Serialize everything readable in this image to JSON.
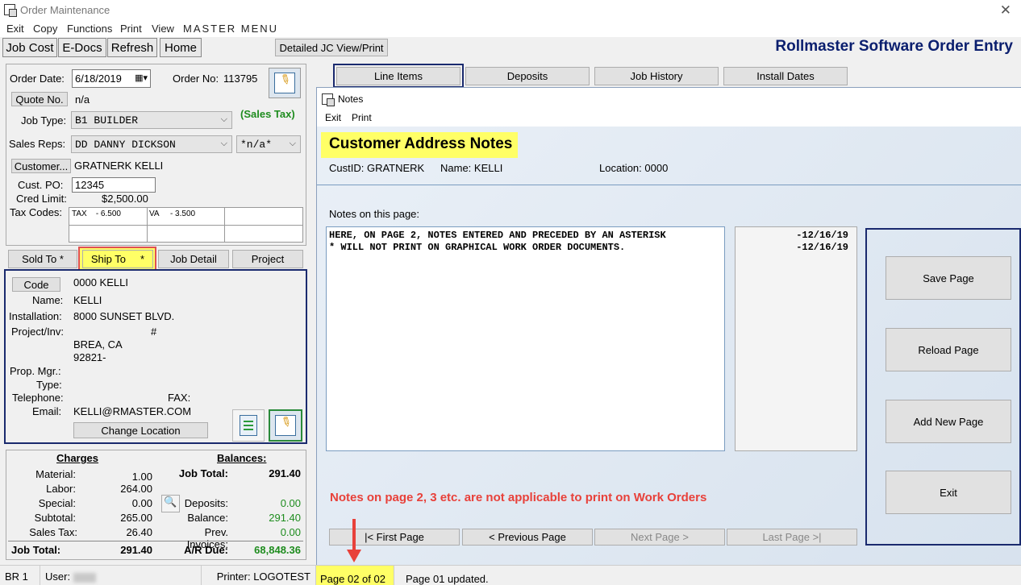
{
  "window": {
    "title": "Order Maintenance",
    "brand": "Rollmaster Software Order Entry",
    "menu": [
      "Exit",
      "Copy",
      "Functions",
      "Print",
      "View",
      "MASTER MENU"
    ]
  },
  "toolbar": {
    "job_cost": "Job Cost",
    "edocs": "E-Docs",
    "refresh": "Refresh",
    "home": "Home",
    "detailed_jc": "Detailed JC View/Print"
  },
  "tabs": [
    "Line Items",
    "Deposits",
    "Job History",
    "Install Dates"
  ],
  "order": {
    "order_date_label": "Order Date:",
    "order_date": "6/18/2019",
    "order_no_label": "Order No:",
    "order_no": "113795",
    "quote_btn": "Quote No.",
    "quote_val": "n/a",
    "job_type_label": "Job Type:",
    "job_type": "B1  BUILDER",
    "sales_tax": "(Sales Tax)",
    "sales_reps_label": "Sales Reps:",
    "sales_rep": "DD   DANNY DICKSON",
    "sales_rep2": "*n/a*",
    "customer_btn": "Customer...",
    "customer_name": "GRATNERK  KELLI",
    "cust_po_label": "Cust. PO:",
    "cust_po": "12345",
    "cred_limit_label": "Cred Limit:",
    "cred_limit": "$2,500.00",
    "tax_codes_label": "Tax Codes:",
    "tax1": "TAX    - 6.500",
    "tax2": "VA     - 3.500"
  },
  "sub_tabs": {
    "sold_to": "Sold To *",
    "ship_to": "Ship To     *",
    "job_detail": "Job Detail",
    "project": "Project"
  },
  "ship": {
    "code_btn": "Code",
    "code_val": "0000 KELLI",
    "name_label": "Name:",
    "name_val": "KELLI",
    "installation_label": "Installation:",
    "installation_val": "8000 SUNSET BLVD.",
    "project_label": "Project/Inv:",
    "hash": "#",
    "city": "BREA, CA",
    "zip": "92821-",
    "prop_mgr_label": "Prop. Mgr.:",
    "type_label": "Type:",
    "telephone_label": "Telephone:",
    "fax_label": "FAX:",
    "email_label": "Email:",
    "email_val": "KELLI@RMASTER.COM",
    "change_location": "Change Location"
  },
  "charges": {
    "header": "Charges",
    "rows": [
      {
        "label": "Material:",
        "value": "1.00"
      },
      {
        "label": "Labor:",
        "value": "264.00"
      },
      {
        "label": "Special:",
        "value": "0.00"
      },
      {
        "label": "Subtotal:",
        "value": "265.00"
      },
      {
        "label": "Sales Tax:",
        "value": "26.40"
      }
    ],
    "job_total_label": "Job Total:",
    "job_total": "291.40"
  },
  "balances": {
    "header": "Balances:",
    "job_total_label": "Job Total:",
    "job_total": "291.40",
    "deposits_label": "Deposits:",
    "deposits": "0.00",
    "balance_label": "Balance:",
    "balance": "291.40",
    "prev_inv_label": "Prev. Invoices:",
    "prev_inv": "0.00",
    "ar_due_label": "A/R Due:",
    "ar_due": "68,848.36"
  },
  "notes": {
    "title": "Notes",
    "menu_exit": "Exit",
    "menu_print": "Print",
    "heading": "Customer Address Notes",
    "custid": "CustID: GRATNERK",
    "name": "Name: KELLI",
    "location": "Location: 0000",
    "notes_on_page": "Notes on this page:",
    "text": "HERE, ON PAGE 2, NOTES ENTERED AND PRECEDED BY AN ASTERISK\n* WILL NOT PRINT ON GRAPHICAL WORK ORDER DOCUMENTS.",
    "dates": [
      "-12/16/19",
      "-12/16/19"
    ],
    "save_page": "Save Page",
    "reload_page": "Reload Page",
    "add_new_page": "Add New Page",
    "exit_btn": "Exit",
    "annotation": "Notes on page 2, 3 etc. are not applicable to print on Work Orders",
    "first_page": "|< First Page",
    "prev_page": "< Previous Page",
    "next_page": "Next Page >",
    "last_page": "Last Page >|",
    "page_indicator": "Page 02 of 02",
    "status": "Page 01 updated."
  },
  "status": {
    "br": "BR 1",
    "user_label": "User:",
    "printer": "Printer: LOGOTEST"
  }
}
